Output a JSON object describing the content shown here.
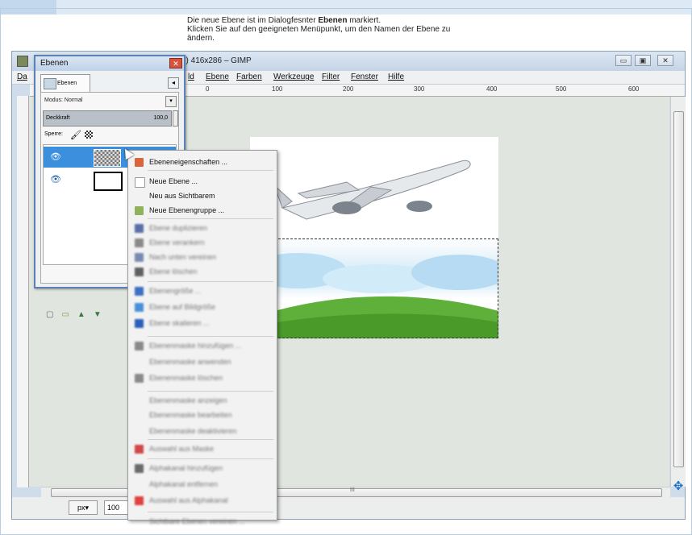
{
  "instruction": {
    "line1_prefix": "Die neue Ebene ist im Dialogfesnter ",
    "line1_bold": "Ebenen",
    "line1_suffix": " markiert.",
    "line2": "Klicken Sie auf den geeigneten Menüpunkt, um den Namen der Ebene zu",
    "line3": "ändern."
  },
  "gimp": {
    "title": "n) 416x286 – GIMP",
    "menu": [
      "Da",
      "ld",
      "Ebene",
      "Farben",
      "Werkzeuge",
      "Filter",
      "Fenster",
      "Hilfe"
    ],
    "ruler_ticks": [
      "0",
      "100",
      "200",
      "300",
      "400",
      "500",
      "600"
    ],
    "unit": "px▾",
    "zoom": "100",
    "scroll_mark": "III"
  },
  "layers_dialog": {
    "title": "Ebenen",
    "tab": "Ebenen",
    "mode_label": "Modus: Normal",
    "opacity_label": "Deckkraft",
    "opacity_value": "100,0",
    "lock_label": "Sperre:"
  },
  "context_menu": [
    {
      "label": "Ebeneneigenschaften ...",
      "enabled": true,
      "icon": "layer-properties-icon",
      "color": "#d8663a"
    },
    {
      "label": "Neue Ebene ...",
      "enabled": true,
      "icon": "new-layer-icon",
      "color": "#ffffff"
    },
    {
      "label": "Neu aus Sichtbarem",
      "enabled": true,
      "icon": "",
      "color": ""
    },
    {
      "label": "Neue Ebenengruppe ...",
      "enabled": true,
      "icon": "folder-icon",
      "color": "#8fb35a"
    },
    {
      "label": "Ebene duplizieren",
      "enabled": false,
      "icon": "duplicate-icon",
      "color": "#5a6fa8"
    },
    {
      "label": "Ebene verankern",
      "enabled": false,
      "icon": "anchor-icon",
      "color": "#8a8a8a"
    },
    {
      "label": "Nach unten vereinen",
      "enabled": false,
      "icon": "merge-down-icon",
      "color": "#7a8ab0"
    },
    {
      "label": "Ebene löschen",
      "enabled": false,
      "icon": "delete-icon",
      "color": "#606060"
    },
    {
      "label": "Ebenengröße ...",
      "enabled": false,
      "icon": "layer-size-icon",
      "color": "#3d6fc2"
    },
    {
      "label": "Ebene auf Bildgröße",
      "enabled": false,
      "icon": "layer-to-image-icon",
      "color": "#4a90d9"
    },
    {
      "label": "Ebene skalieren ...",
      "enabled": false,
      "icon": "scale-icon",
      "color": "#2e5fb8"
    },
    {
      "label": "Ebenenmaske hinzufügen ...",
      "enabled": false,
      "icon": "mask-icon",
      "color": "#8a8a8a"
    },
    {
      "label": "Ebenenmaske anwenden",
      "enabled": false,
      "icon": "",
      "color": ""
    },
    {
      "label": "Ebenenmaske löschen",
      "enabled": false,
      "icon": "mask-delete-icon",
      "color": "#8a8a8a"
    },
    {
      "label": "Ebenenmaske anzeigen",
      "enabled": false,
      "icon": "",
      "color": ""
    },
    {
      "label": "Ebenenmaske bearbeiten",
      "enabled": false,
      "icon": "",
      "color": ""
    },
    {
      "label": "Ebenenmaske deaktivieren",
      "enabled": false,
      "icon": "",
      "color": ""
    },
    {
      "label": "Auswahl aus Maske",
      "enabled": false,
      "icon": "mask-selection-icon",
      "color": "#d04848"
    },
    {
      "label": "Alphakanal hinzufügen",
      "enabled": false,
      "icon": "alpha-icon",
      "color": "#6a6a6a"
    },
    {
      "label": "Alphakanal entfernen",
      "enabled": false,
      "icon": "",
      "color": ""
    },
    {
      "label": "Auswahl aus Alphakanal",
      "enabled": false,
      "icon": "alpha-selection-icon",
      "color": "#e04040"
    },
    {
      "label": "Sichtbare Ebenen vereinen ...",
      "enabled": false,
      "icon": "",
      "color": ""
    }
  ]
}
